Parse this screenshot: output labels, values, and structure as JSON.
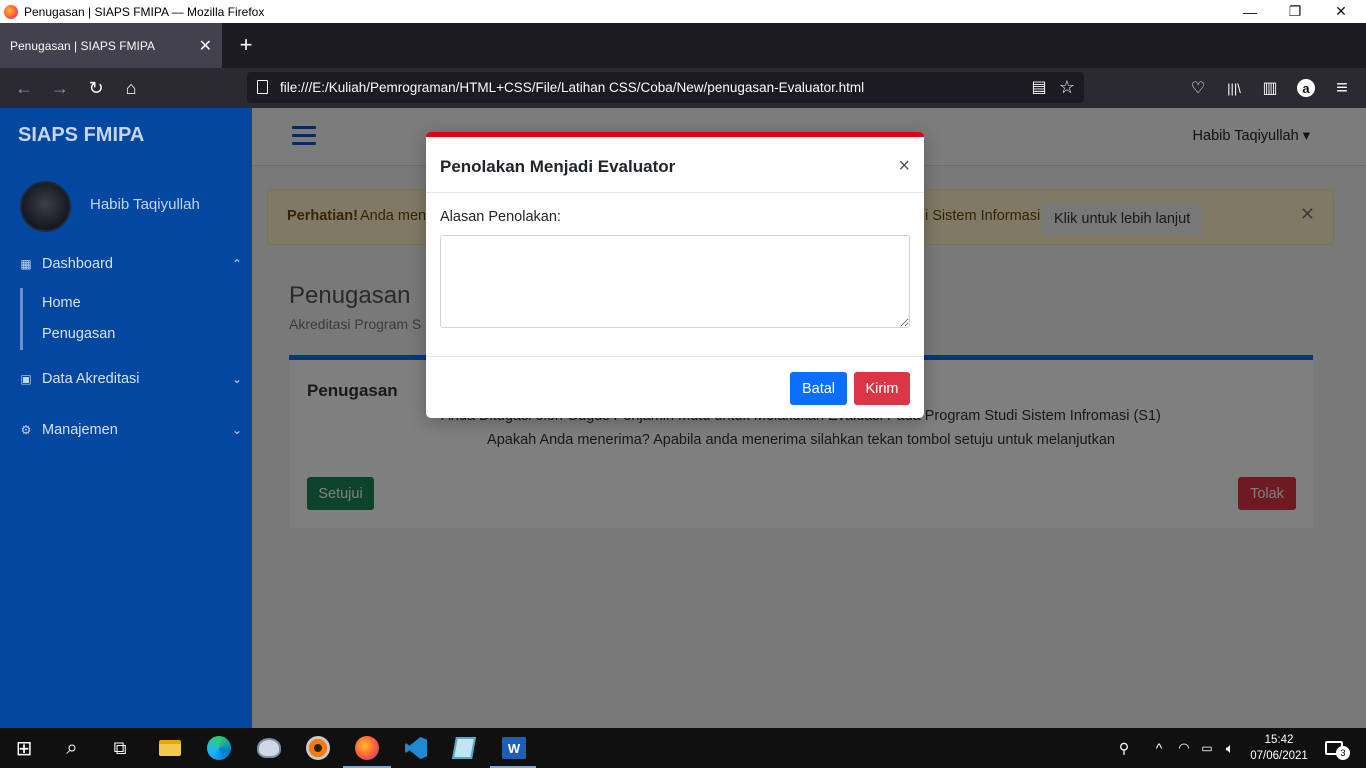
{
  "window": {
    "title": "Penugasan | SIAPS FMIPA — Mozilla Firefox",
    "minimize": "—",
    "restore": "❐",
    "close": "✕"
  },
  "tabs": [
    {
      "label": "Penugasan | SIAPS FMIPA",
      "close": "✕"
    }
  ],
  "toolbar": {
    "new_tab": "+",
    "back": "←",
    "forward": "→",
    "reload": "↻",
    "home": "⌂",
    "url": "file:///E:/Kuliah/Pemrograman/HTML+CSS/File/Latihan CSS/Coba/New/penugasan-Evaluator.html",
    "reader_icon": "▤",
    "star_icon": "☆",
    "pocket_icon": "♡",
    "library_icon": "|||\\",
    "sidebar_icon": "▥",
    "amazon_icon": "a",
    "menu_icon": "≡"
  },
  "sidebar": {
    "brand": "SIAPS FMIPA",
    "user_name": "Habib Taqiyullah",
    "items": [
      {
        "label": "Dashboard",
        "icon": "▦",
        "chevron": "⌃"
      },
      {
        "label": "Data Akreditasi",
        "icon": "▣",
        "chevron": "⌄"
      },
      {
        "label": "Manajemen",
        "icon": "⚙",
        "chevron": "⌄"
      }
    ],
    "subitems": [
      {
        "label": "Home"
      },
      {
        "label": "Penugasan"
      }
    ]
  },
  "topbar": {
    "user_menu": "Habib Taqiyullah ▾"
  },
  "alert": {
    "strong": "Perhatian!",
    "text_left": "Anda men",
    "text_right": "i Sistem Informasi",
    "link": "Klik untuk lebih lanjut",
    "close": "✕"
  },
  "page": {
    "title": "Penugasan",
    "subtitle": "Akreditasi Program S"
  },
  "card": {
    "title": "Penugasan",
    "line1": "Anda Ditugasi oleh Gugus Penjamin Mutu untuk Melakukan Evaluasi Pada Program Studi Sistem Infromasi (S1)",
    "line2": "Apakah Anda menerima? Apabila anda menerima silahkan tekan tombol setuju untuk melanjutkan",
    "accept": "Setujui",
    "reject": "Tolak"
  },
  "modal": {
    "title": "Penolakan Menjadi Evaluator",
    "close": "×",
    "label": "Alasan Penolakan:",
    "textarea_value": "",
    "cancel": "Batal",
    "submit": "Kirim"
  },
  "taskbar": {
    "start": "⊞",
    "search": "⌕",
    "task_view": "⧉",
    "time": "15:42",
    "date": "07/06/2021",
    "notifications": "3"
  },
  "colors": {
    "sidebar_bg": "#0347a0",
    "modal_accent": "#e3000f",
    "primary": "#0d6efd",
    "danger": "#dc3545",
    "success": "#198754"
  }
}
